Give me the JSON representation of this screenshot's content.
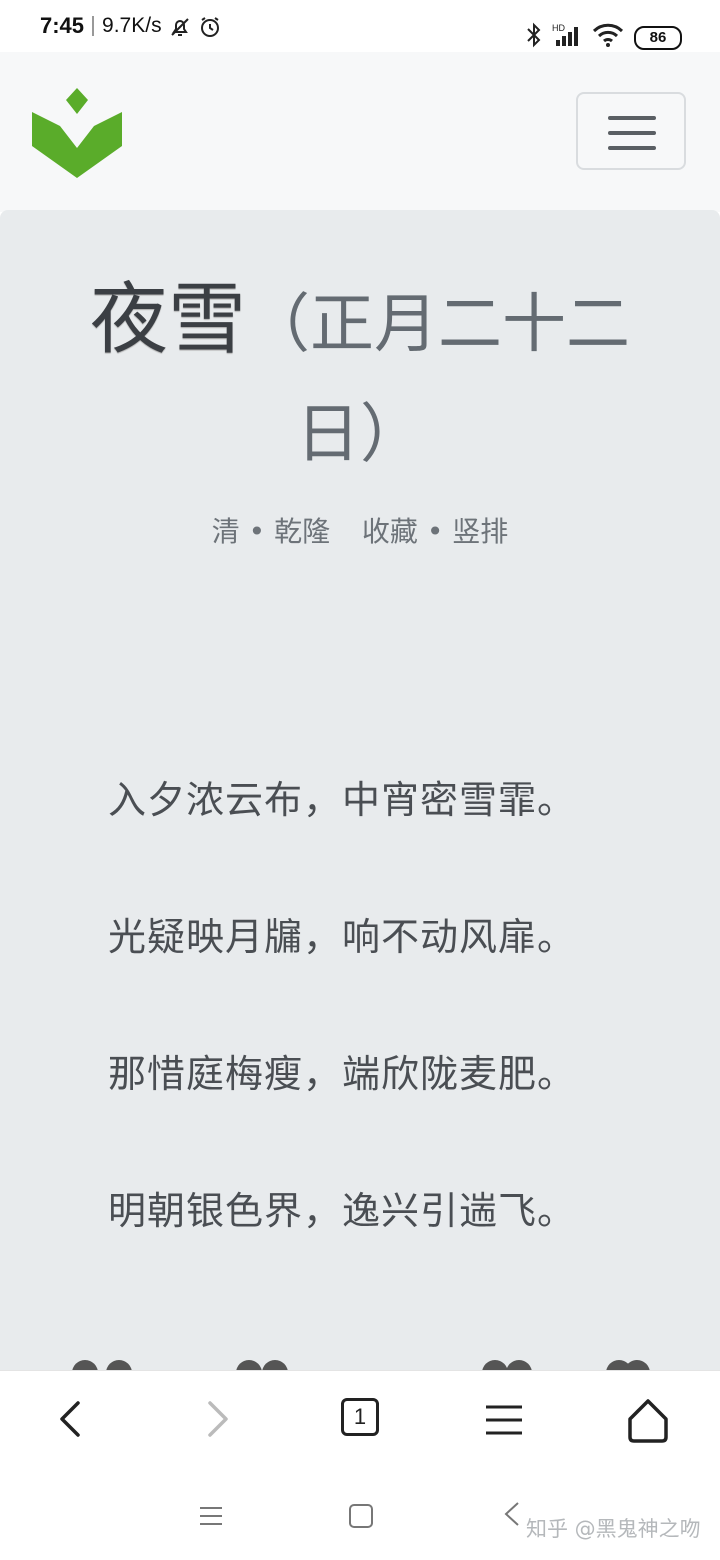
{
  "status_bar": {
    "time": "7:45",
    "speed": "9.7K/s",
    "battery": "86",
    "icons": [
      "mute-bell-icon",
      "alarm-icon",
      "bluetooth-icon",
      "hd-signal-icon",
      "wifi-icon",
      "battery-icon"
    ]
  },
  "header": {
    "logo_icon": "site-logo-icon",
    "menu_icon": "hamburger-menu-icon",
    "colors": {
      "logo_green": "#5aac2a",
      "background": "#f7f8f9"
    }
  },
  "poem": {
    "title": "夜雪",
    "date": "（正月二十二日）",
    "dynasty": "清",
    "author": "乾隆",
    "action_collect": "收藏",
    "action_vertical": "竖排",
    "lines": [
      "入夕浓云布，中宵密雪霏。",
      "光疑映月牖，响不动风扉。",
      "那惜庭梅瘦，端欣陇麦肥。",
      "明朝银色界，逸兴引遄飞。"
    ]
  },
  "browser_toolbar": {
    "back_icon": "back-chevron-icon",
    "forward_icon": "forward-chevron-icon",
    "tab_count": "1",
    "menu_icon": "menu-icon",
    "home_icon": "home-icon"
  },
  "system_nav": {
    "recents_icon": "recents-icon",
    "home_icon": "square-home-icon",
    "back_icon": "back-icon",
    "watermark": "知乎 @黑鬼神之吻"
  }
}
